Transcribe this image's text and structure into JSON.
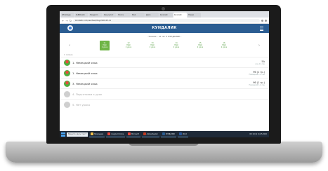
{
  "browser": {
    "tabs": [
      {
        "label": "WhatsApp"
      },
      {
        "label": "KUNDALIK"
      },
      {
        "label": "Telegram"
      },
      {
        "label": "Результат"
      },
      {
        "label": "Почта"
      },
      {
        "label": "Mail"
      },
      {
        "label": "Диск"
      },
      {
        "label": "Kundalik"
      },
      {
        "label": "Kundalik",
        "active": true
      },
      {
        "label": "Новая"
      }
    ],
    "url": "kundalik.com/userfeed/day/2020-05-11"
  },
  "app": {
    "brand": "КУНДАЛИК",
    "student": "Ученик - uz. av. 3 КУНДАЛИК"
  },
  "days": [
    {
      "date": "11",
      "month": "Май",
      "label": "2 урок",
      "active": true
    },
    {
      "date": "12",
      "month": "Май",
      "label": "2 урок"
    },
    {
      "date": "13",
      "month": "Май",
      "label": "2 урок"
    },
    {
      "date": "14",
      "month": "Май",
      "label": "2 урок"
    },
    {
      "date": "15",
      "month": "Май",
      "label": "2 урок"
    },
    {
      "date": "16",
      "month": "Май",
      "label": "2 урок"
    }
  ],
  "section_label": "1 смена",
  "subjects": [
    {
      "name": "1. Немецкий язык",
      "mark": "5А",
      "note": "ноц 11 сен",
      "icon": "book-icon"
    },
    {
      "name": "1. Немецкий язык",
      "mark": "9б (1 гр.)",
      "note": "Немецкий 1-2 сен",
      "icon": "book-icon"
    },
    {
      "name": "3. Немецкий язык",
      "mark": "9б (1 гр.)",
      "note": "Немецкий 1-2 сен",
      "icon": "book-icon"
    },
    {
      "name": "4. Подготовка к урок",
      "mark": "",
      "note": "",
      "icon": "placeholder-icon",
      "muted": true
    },
    {
      "name": "5. Нет урока",
      "mark": "",
      "note": "",
      "icon": "placeholder-icon",
      "muted": true
    }
  ],
  "taskbar": {
    "search": "Введите здесь текст",
    "items": [
      {
        "label": "Проводник",
        "color": "#f3c14b"
      },
      {
        "label": "Google Chrome",
        "color": "#e8453c"
      },
      {
        "label": "Microsoft",
        "color": "#e8453c"
      },
      {
        "label": "Adobe Reader",
        "color": "#c23b22"
      },
      {
        "label": "КУНДАЛИК",
        "color": "#2b5d92"
      },
      {
        "label": "Word",
        "color": "#2b579a"
      }
    ],
    "tray": "RU  10:41  11.05.2020"
  }
}
